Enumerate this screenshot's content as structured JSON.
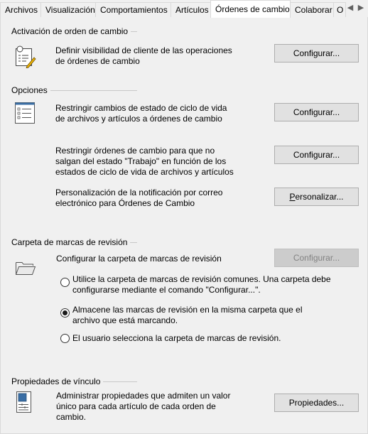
{
  "tabs": [
    {
      "label": "Archivos",
      "active": false
    },
    {
      "label": "Visualización",
      "active": false
    },
    {
      "label": "Comportamientos",
      "active": false
    },
    {
      "label": "Artículos",
      "active": false
    },
    {
      "label": "Órdenes de cambio",
      "active": true
    },
    {
      "label": "Colaborar",
      "active": false
    },
    {
      "label": "O",
      "active": false
    }
  ],
  "sections": {
    "activation": {
      "title": "Activación de orden de cambio",
      "row": {
        "desc_line1": "Definir visibilidad de cliente de las operaciones",
        "desc_line2": "de órdenes de cambio",
        "button": "Configurar...",
        "icon": "lightbulb-checklist-icon"
      }
    },
    "options": {
      "title": "Opciones",
      "row1": {
        "desc_line1": "Restringir cambios de estado de ciclo de vida",
        "desc_line2": "de archivos y artículos a órdenes de cambio",
        "button": "Configurar...",
        "icon": "list-form-icon"
      },
      "row2": {
        "desc_line1": "Restringir órdenes de cambio para que no",
        "desc_line2": "salgan del estado \"Trabajo\" en función de los",
        "desc_line3": "estados de ciclo de vida de archivos y artículos",
        "button": "Configurar..."
      },
      "row3": {
        "desc_line1": "Personalización de la notificación por correo",
        "desc_line2": "electrónico para Órdenes de Cambio",
        "button_mnemonic": "P",
        "button_rest": "ersonalizar..."
      }
    },
    "markup": {
      "title": "Carpeta de marcas de revisión",
      "desc": "Configurar la carpeta de marcas de revisión",
      "button": "Configurar...",
      "icon": "folder-open-icon",
      "radios": [
        {
          "line1": "Utilice la carpeta de marcas de revisión comunes. Una carpeta debe",
          "line2": "configurarse mediante el comando \"Configurar...\".",
          "checked": false
        },
        {
          "line1": "Almacene las marcas de revisión en la misma carpeta que el",
          "line2": "archivo que está marcando.",
          "checked": true
        },
        {
          "line1": "El usuario selecciona la carpeta de marcas de revisión.",
          "line2": "",
          "checked": false
        }
      ]
    },
    "link": {
      "title": "Propiedades de vínculo",
      "desc_line1": "Administrar propiedades que admiten un valor",
      "desc_line2": "único para cada artículo de cada orden de",
      "desc_line3": "cambio.",
      "button": "Propiedades...",
      "icon": "properties-sheet-icon"
    }
  },
  "colors": {
    "panel_bg": "#f0f0f0",
    "button_bg": "#e1e1e1",
    "button_border": "#adadad",
    "disabled_text": "#838383"
  }
}
